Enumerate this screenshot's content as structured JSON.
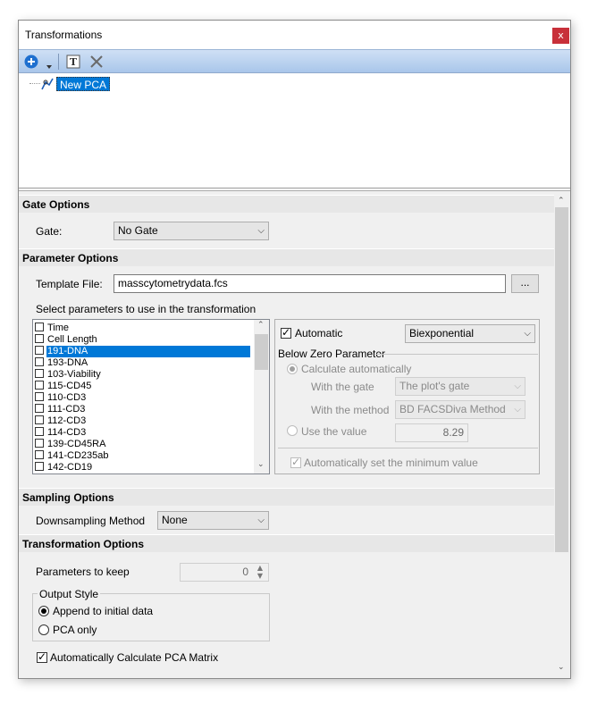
{
  "window": {
    "title": "Transformations",
    "close_glyph": "x"
  },
  "toolbar": {
    "icons": [
      "add-icon",
      "dropdown-arrow-icon",
      "rename-icon",
      "delete-icon"
    ]
  },
  "tree": {
    "items": [
      {
        "label": "New PCA",
        "icon": "pca-transform-icon",
        "selected": true
      }
    ]
  },
  "gate_options": {
    "header": "Gate Options",
    "gate_label": "Gate:",
    "gate_value": "No Gate"
  },
  "parameter_options": {
    "header": "Parameter Options",
    "template_label": "Template File:",
    "template_value": "masscytometrydata.fcs",
    "browse_label": "...",
    "select_label": "Select parameters to use in the transformation",
    "parameters": [
      {
        "label": "Time",
        "checked": false,
        "selected": false
      },
      {
        "label": "Cell Length",
        "checked": false,
        "selected": false
      },
      {
        "label": "191-DNA",
        "checked": false,
        "selected": true
      },
      {
        "label": "193-DNA",
        "checked": false,
        "selected": false
      },
      {
        "label": "103-Viability",
        "checked": false,
        "selected": false
      },
      {
        "label": "115-CD45",
        "checked": false,
        "selected": false
      },
      {
        "label": "110-CD3",
        "checked": false,
        "selected": false
      },
      {
        "label": "111-CD3",
        "checked": false,
        "selected": false
      },
      {
        "label": "112-CD3",
        "checked": false,
        "selected": false
      },
      {
        "label": "114-CD3",
        "checked": false,
        "selected": false
      },
      {
        "label": "139-CD45RA",
        "checked": false,
        "selected": false
      },
      {
        "label": "141-CD235ab",
        "checked": false,
        "selected": false
      },
      {
        "label": "142-CD19",
        "checked": false,
        "selected": false
      }
    ],
    "automatic_label": "Automatic",
    "automatic_checked": true,
    "scale_value": "Biexponential",
    "below_zero_title": "Below Zero Parameter",
    "calc_auto_label": "Calculate automatically",
    "with_gate_label": "With the gate",
    "with_gate_value": "The plot's gate",
    "with_method_label": "With the method",
    "with_method_value": "BD FACSDiva Method",
    "use_value_label": "Use the value",
    "use_value": "8.29",
    "auto_min_label": "Automatically set the minimum value"
  },
  "sampling_options": {
    "header": "Sampling Options",
    "downsampling_label": "Downsampling Method",
    "downsampling_value": "None"
  },
  "transformation_options": {
    "header": "Transformation Options",
    "params_keep_label": "Parameters to keep",
    "params_keep_value": "0",
    "output_style_title": "Output Style",
    "append_label": "Append to initial data",
    "pca_only_label": "PCA only",
    "output_selected": "append",
    "auto_calc_label": "Automatically Calculate PCA Matrix",
    "auto_calc_checked": true
  }
}
